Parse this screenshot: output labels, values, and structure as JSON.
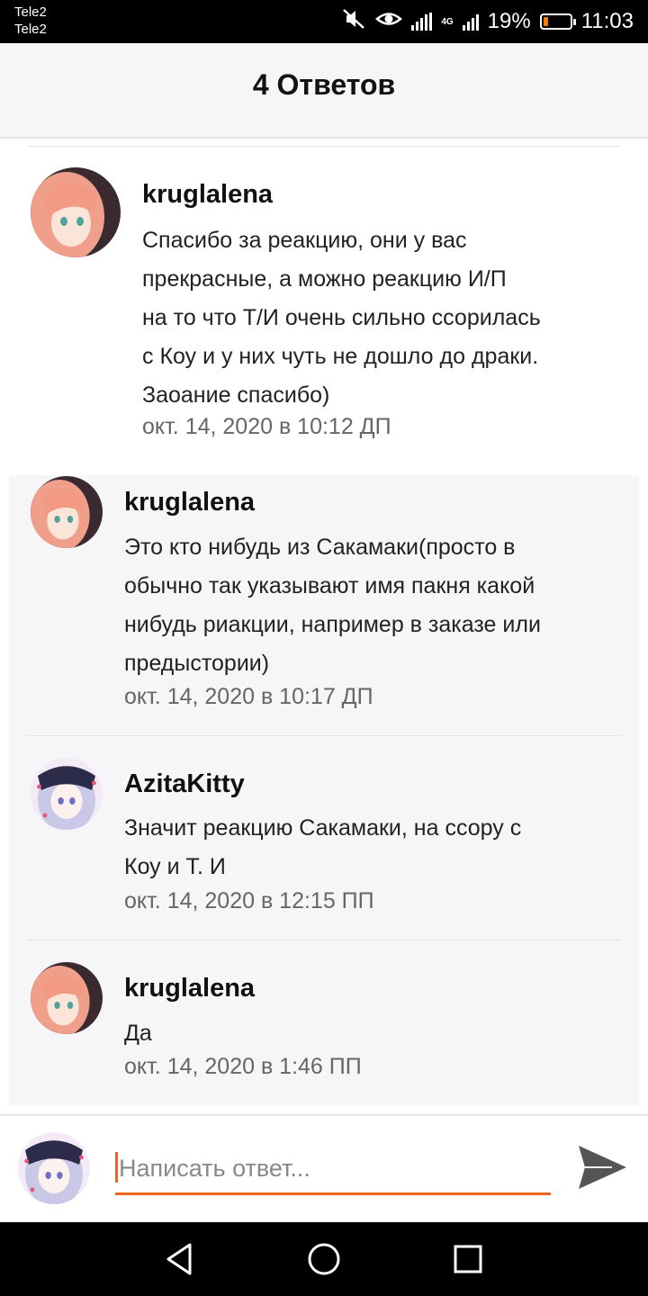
{
  "status_bar": {
    "carrier_1": "Tele2",
    "carrier_2": "Tele2",
    "network": "4G",
    "battery_level": "19%",
    "battery_fraction": 0.19,
    "time": "11:03",
    "battery_color": "#ff7a00"
  },
  "header": {
    "title": "4 Ответов"
  },
  "main_comment": {
    "username": "kruglalena",
    "text": "Спасибо за реакцию, они у вас прекрасные, а  можно реакцию И/П на то что Т/И очень сильно ссорилась с Коу и у них чуть не дошло до драки. Заоание спасибо)",
    "lines": [
      "Спасибо за реакцию, они у вас",
      "прекрасные, а  можно реакцию И/П",
      "на то что Т/И очень сильно ссорилась",
      "с Коу и у них чуть не дошло до драки.",
      "Заоание спасибо)"
    ],
    "timestamp": "окт. 14, 2020 в 10:12 ДП"
  },
  "replies": [
    {
      "username": "kruglalena",
      "lines": [
        "Это кто нибудь из Сакамаки(просто в",
        "обычно так указывают имя пакня какой",
        "нибудь риакции, например в заказе или",
        "предыстории)"
      ],
      "timestamp": "окт. 14, 2020 в 10:17 ДП"
    },
    {
      "username": "AzitaKitty",
      "lines": [
        "Значит реакцию Сакамаки, на ссору с",
        "Коу и Т. И"
      ],
      "timestamp": "окт. 14, 2020 в 12:15 ПП"
    },
    {
      "username": "kruglalena",
      "lines": [
        "Да"
      ],
      "timestamp": "окт. 14, 2020 в 1:46 ПП"
    }
  ],
  "reply_box": {
    "placeholder": "Написать ответ...",
    "value": ""
  },
  "icons": {
    "send": "send-icon",
    "back": "back-triangle-icon",
    "home": "home-circle-icon",
    "recents": "recents-square-icon"
  },
  "colors": {
    "accent": "#ec6420",
    "replies_background": "#f6f5f8"
  }
}
